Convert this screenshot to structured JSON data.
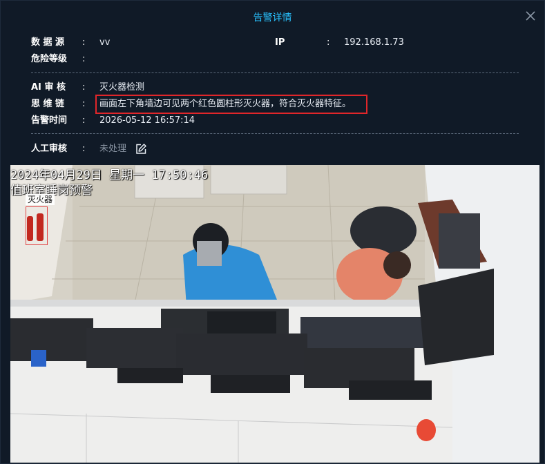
{
  "dialog": {
    "title": "告警详情",
    "close_icon": "close-icon"
  },
  "info": {
    "source_label": "数 据 源",
    "source_value": "vv",
    "ip_label": "IP",
    "ip_value": "192.168.1.73",
    "risk_label": "危险等级",
    "risk_value": "",
    "ai_label": "AI 审 核",
    "ai_value": "灭火器检测",
    "chain_label": "思 维 链",
    "chain_value": "画面左下角墙边可见两个红色圆柱形灭火器，符合灭火器特征。",
    "time_label": "告警时间",
    "time_value": "2026-05-12 16:57:14",
    "manual_label": "人工审核",
    "manual_value": "未处理",
    "colon": ":"
  },
  "photo": {
    "osd_line1": "2024年04月29日 星期一 17:50:46",
    "osd_line2": "值班室睡岗预警",
    "detection_label": "灭火器"
  },
  "colors": {
    "accent": "#29c2ff",
    "highlight_border": "#e0262a"
  }
}
